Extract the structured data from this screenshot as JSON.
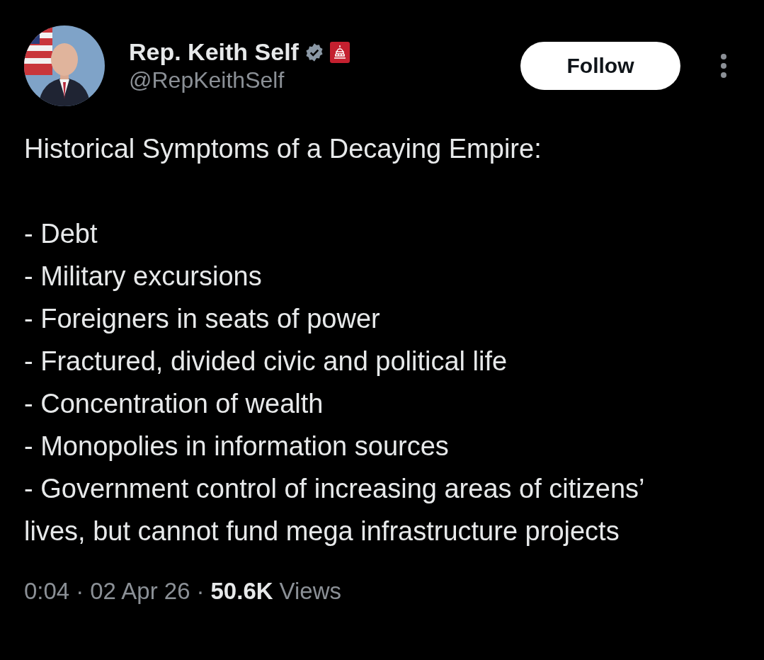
{
  "author": {
    "name": "Rep. Keith Self",
    "handle": "@RepKeithSelf",
    "verified": true
  },
  "follow_button": {
    "label": "Follow"
  },
  "post": {
    "heading": "Historical Symptoms of a Decaying Empire:",
    "items": [
      "- Debt",
      "- Military excursions",
      "- Foreigners in seats of power",
      "- Fractured, divided civic and political life",
      "- Concentration of wealth",
      "- Monopolies in information sources",
      "- Government control of increasing areas of citizens’ lives, but cannot fund mega infrastructure projects"
    ]
  },
  "meta": {
    "time": "0:04",
    "separator_1": "·",
    "date": "02 Apr 26",
    "separator_2": "·",
    "views_count": "50.6K",
    "views_label": "Views"
  }
}
